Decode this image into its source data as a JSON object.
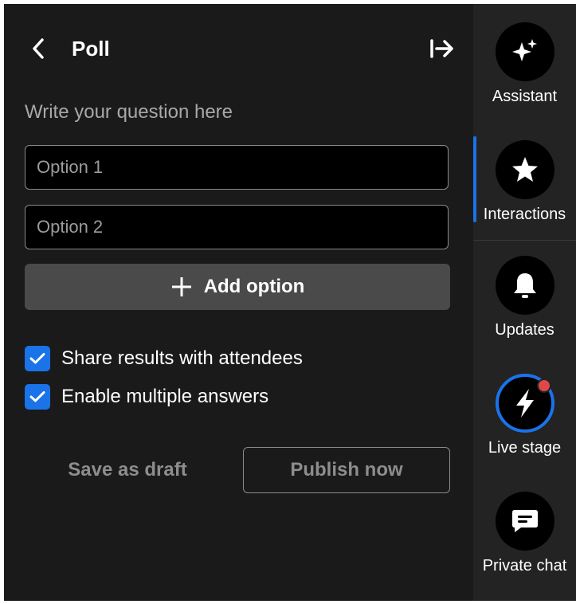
{
  "poll": {
    "title": "Poll",
    "question_placeholder": "Write your question here",
    "option1_placeholder": "Option 1",
    "option2_placeholder": "Option 2",
    "add_option_label": "Add option",
    "share_results_label": "Share results with attendees",
    "share_results_checked": true,
    "multiple_answers_label": "Enable multiple answers",
    "multiple_answers_checked": true,
    "save_draft_label": "Save as draft",
    "publish_label": "Publish now"
  },
  "sidebar": {
    "items": [
      {
        "label": "Assistant",
        "icon": "sparkle-icon"
      },
      {
        "label": "Interactions",
        "icon": "star-icon",
        "active": true
      },
      {
        "label": "Updates",
        "icon": "bell-icon"
      },
      {
        "label": "Live stage",
        "icon": "lightning-icon",
        "notification": true
      },
      {
        "label": "Private chat",
        "icon": "chat-icon"
      }
    ]
  },
  "colors": {
    "accent": "#1a73e8",
    "panel_bg": "#1a1a1a",
    "sidebar_bg": "#232323",
    "notification": "#e04848"
  }
}
